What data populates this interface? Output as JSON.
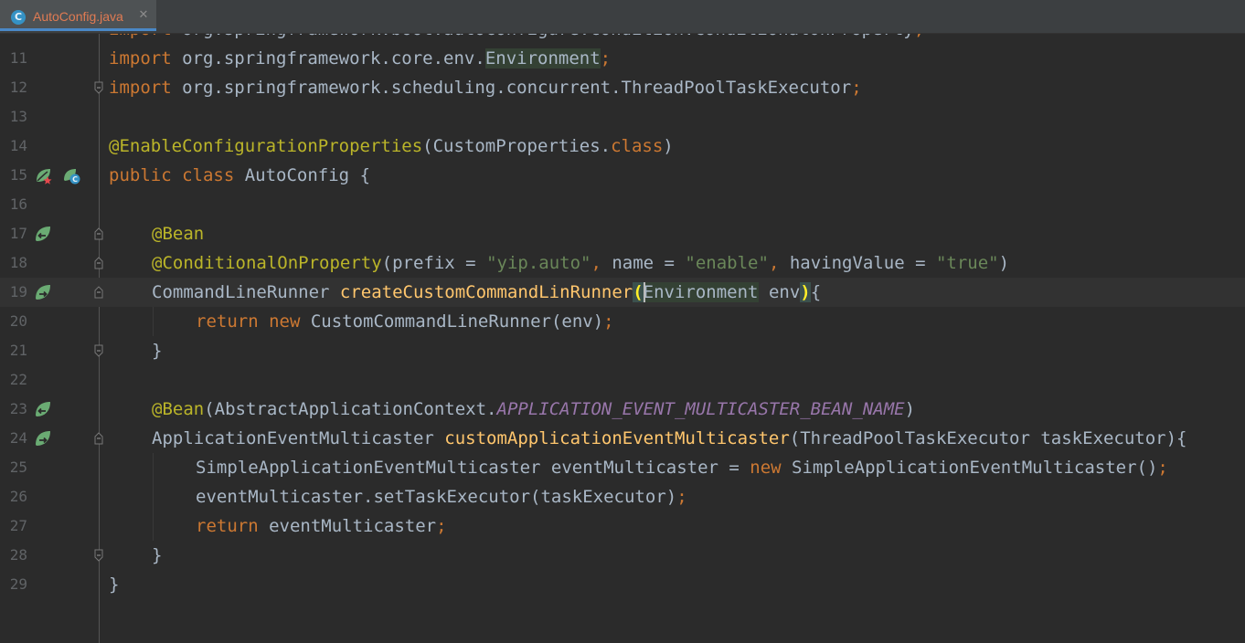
{
  "tab": {
    "label": "AutoConfig.java",
    "icon_letter": "C",
    "close": "✕"
  },
  "colors": {
    "keyword": "#cc7832",
    "annotation": "#bbb529",
    "string": "#6a8759",
    "method": "#ffc66d",
    "constant": "#9876aa",
    "plain": "#a9b7c6",
    "line_number": "#606366",
    "background": "#2b2b2b",
    "spring_icon": "#6aab73"
  },
  "current_line": "19",
  "lines": [
    {
      "num": "",
      "code": {
        "a": "import org.springframework.boot.autoconfigure.condition.ConditionalOnProperty;"
      }
    },
    {
      "num": "11",
      "code": {
        "kw": "import",
        "rest": " org.springframework.core.env.",
        "env": "Environment",
        "semi": ";"
      }
    },
    {
      "num": "12",
      "code": {
        "kw": "import",
        "rest": " org.springframework.scheduling.concurrent.ThreadPoolTaskExecutor",
        "semi": ";"
      }
    },
    {
      "num": "13"
    },
    {
      "num": "14",
      "code": {
        "ann": "@EnableConfigurationProperties",
        "p1": "(CustomProperties.",
        "kw": "class",
        "p2": ")"
      }
    },
    {
      "num": "15",
      "code": {
        "kw1": "public",
        "sp": " ",
        "kw2": "class",
        "rest": " AutoConfig {"
      }
    },
    {
      "num": "16"
    },
    {
      "num": "17",
      "code": {
        "ann": "@Bean"
      }
    },
    {
      "num": "18",
      "code": {
        "ann": "@ConditionalOnProperty",
        "p1": "(prefix = ",
        "s1": "\"yip.auto\"",
        "c1": ",",
        "p2": " name = ",
        "s2": "\"enable\"",
        "c2": ",",
        "p3": " havingValue = ",
        "s3": "\"true\"",
        "p4": ")"
      }
    },
    {
      "num": "19",
      "code": {
        "t": "CommandLineRunner ",
        "fn": "createCustomCommandLinRunner",
        "open": "(",
        "env": "Environment",
        "arg": " env",
        "close": ")",
        "rest": "{"
      }
    },
    {
      "num": "20",
      "code": {
        "kw1": "return",
        "sp": " ",
        "kw2": "new",
        "rest": " CustomCommandLineRunner(env)",
        "semi": ";"
      }
    },
    {
      "num": "21",
      "code": {
        "a": "}"
      }
    },
    {
      "num": "22"
    },
    {
      "num": "23",
      "code": {
        "ann": "@Bean",
        "p1": "(AbstractApplicationContext.",
        "cst": "APPLICATION_EVENT_MULTICASTER_BEAN_NAME",
        "p2": ")"
      }
    },
    {
      "num": "24",
      "code": {
        "t": "ApplicationEventMulticaster ",
        "fn": "customApplicationEventMulticaster",
        "rest": "(ThreadPoolTaskExecutor taskExecutor){"
      }
    },
    {
      "num": "25",
      "code": {
        "t": "SimpleApplicationEventMulticaster eventMulticaster = ",
        "kw": "new",
        "rest": " SimpleApplicationEventMulticaster()",
        "semi": ";"
      }
    },
    {
      "num": "26",
      "code": {
        "t": "eventMulticaster.setTaskExecutor(taskExecutor)",
        "semi": ";"
      }
    },
    {
      "num": "27",
      "code": {
        "kw": "return",
        "rest": " eventMulticaster",
        "semi": ";"
      }
    },
    {
      "num": "28",
      "code": {
        "a": "}"
      }
    },
    {
      "num": "29",
      "code": {
        "a": "}"
      }
    }
  ]
}
